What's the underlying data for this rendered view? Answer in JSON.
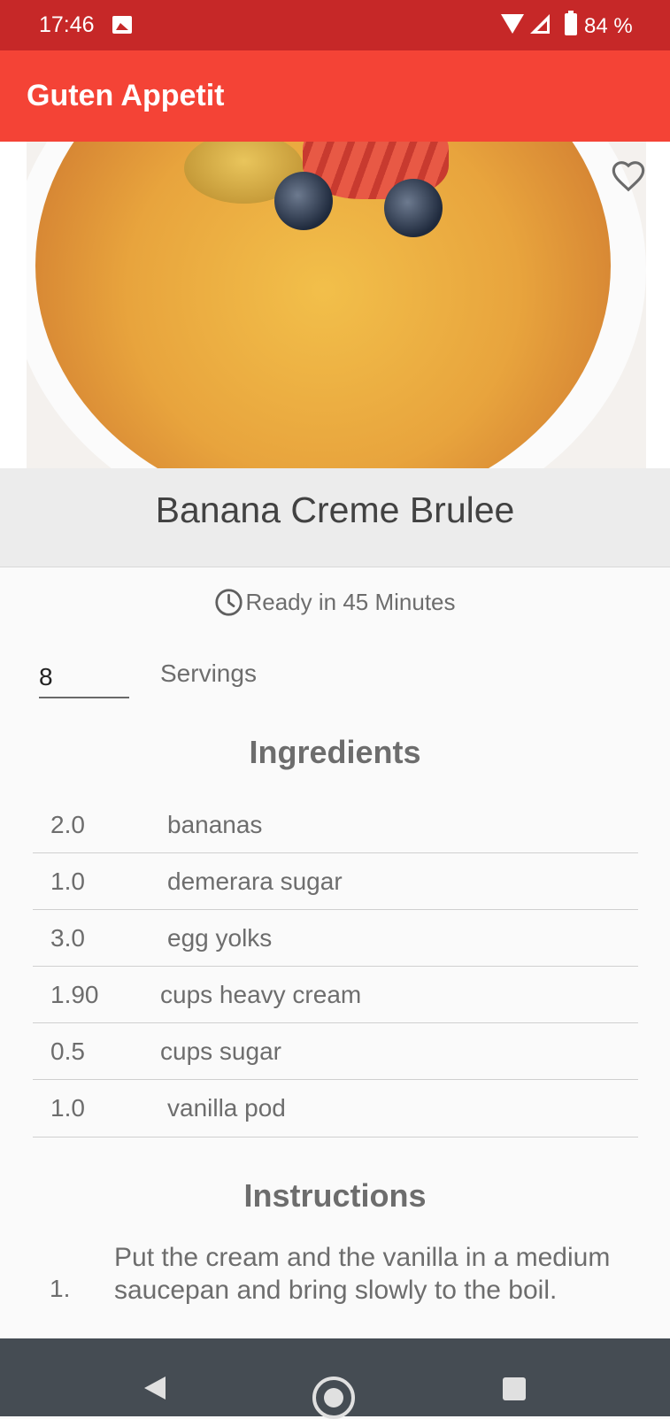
{
  "status_bar": {
    "time": "17:46",
    "battery": "84 %"
  },
  "app_bar": {
    "title": "Guten Appetit"
  },
  "recipe": {
    "title": "Banana Creme Brulee",
    "ready_in": "Ready in 45 Minutes",
    "servings_value": "8",
    "servings_label": "Servings",
    "favorite_icon": "heart-outline-icon"
  },
  "ingredients": {
    "heading": "Ingredients",
    "items": [
      {
        "qty": "2.0",
        "name": "bananas"
      },
      {
        "qty": "1.0",
        "name": "demerara sugar"
      },
      {
        "qty": "3.0",
        "name": "egg yolks"
      },
      {
        "qty": "1.90",
        "name": "cups heavy cream"
      },
      {
        "qty": "0.5",
        "name": "cups sugar"
      },
      {
        "qty": "1.0",
        "name": "vanilla pod"
      }
    ]
  },
  "instructions": {
    "heading": "Instructions",
    "steps": [
      {
        "number": "1.",
        "text": "Put the cream and the vanilla in a medium saucepan and bring slowly to the boil."
      }
    ]
  },
  "colors": {
    "status_bar": "#c62828",
    "app_bar": "#f44336",
    "nav_bar": "#454c53"
  }
}
